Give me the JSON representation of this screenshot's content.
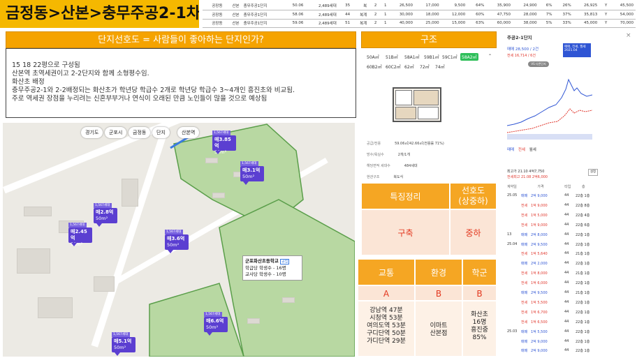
{
  "title": "금정동>산본>충무주공2-1차",
  "top_table": [
    [
      "공장동",
      "산본",
      "충무주공1단지",
      "50.06",
      "2,489세대",
      "35",
      "복",
      "2",
      "1",
      "26,500",
      "17,000",
      "9,500",
      "64%",
      "35,900",
      "24,900",
      "6%",
      "26%",
      "26,925",
      "Y",
      "45,500"
    ],
    [
      "공장동",
      "산본",
      "충무주공1단지",
      "58.06",
      "2,489세대",
      "44",
      "복계",
      "2",
      "1",
      "30,000",
      "18,000",
      "12,000",
      "60%",
      "47,750",
      "28,000",
      "7%",
      "37%",
      "35,813",
      "Y",
      "54,000"
    ],
    [
      "공장동",
      "산본",
      "충무주공1단지",
      "59.06",
      "2,489세대",
      "51",
      "복계",
      "2",
      "1",
      "40,000",
      "25,000",
      "15,000",
      "63%",
      "60,000",
      "38,000",
      "5%",
      "33%",
      "45,000",
      "Y",
      "70,000"
    ]
  ],
  "desc": {
    "header": "단지선호도 = 사람들이 좋아하는 단지인가?",
    "lines": [
      "15 18 22평으로 구성됨",
      "산본역 초역세권이고 2-2단지와 함께 소형평수임.",
      "화산초 배정",
      "충무주공2-1와 2-2배정되는 화산초가 학년당 학급수 2개로 학년당 학급수 3~4개인 흥진초와 비교됨.",
      "주로 역세권 장점을 누리려는 신혼부부거나 연식이 오래된 만큼 노인들이 많을 것으로 예상됨"
    ]
  },
  "map": {
    "chips": [
      "경기도",
      "군포시",
      "금정동",
      "단지"
    ],
    "station": "산본역",
    "pins": [
      {
        "label": "매3.85억",
        "sub": "50m²"
      },
      {
        "label": "매3.1억",
        "sub": "50m²"
      },
      {
        "label": "매2.8억",
        "sub": "50m²"
      },
      {
        "label": "매2.45억",
        "sub": "50m²"
      },
      {
        "label": "매3.6억",
        "sub": "50m²"
      },
      {
        "label": "매6.6억",
        "sub": "50m²"
      },
      {
        "label": "매5.1억",
        "sub": "50m²"
      }
    ],
    "school": {
      "name": "군포화산초등학교",
      "badge": "공립",
      "line1": "학급당 학생수 - 16명",
      "line2": "교사당 학생수 - 10명"
    }
  },
  "structure": {
    "header": "구조",
    "sizes_row1": [
      "50A㎡",
      "51B㎡",
      "58A1㎡",
      "59B1㎡",
      "59C1㎡",
      "58A2㎡"
    ],
    "sizes_row2": [
      "60B2㎡",
      "60C2㎡",
      "62㎡",
      "72㎡",
      "74㎡"
    ],
    "active_size": "58A2㎡",
    "specs": [
      {
        "k": "공급/전용",
        "v": "59.06㎡/42.66㎡(전용률 71%)"
      },
      {
        "k": "방수/욕실수",
        "v": "2개/1개"
      },
      {
        "k": "해당면적 세대수",
        "v": "484세대"
      },
      {
        "k": "현관구조",
        "v": "복도식"
      }
    ]
  },
  "summary": {
    "feature_label": "특징정리",
    "pref_label": "선호도\n(상중하)",
    "feature_value": "구축",
    "pref_value": "중하",
    "cols": [
      "교통",
      "환경",
      "학군"
    ],
    "grades": [
      "A",
      "B",
      "B"
    ],
    "transport": [
      "강남역 47분",
      "시청역 53분",
      "여의도역 53분",
      "구디단역 50분",
      "가디단역 29분"
    ],
    "environment": [
      "이마트",
      "산본점"
    ],
    "school": [
      "화산초",
      "16명",
      "흥진중",
      "85%"
    ]
  },
  "right_panel": {
    "title": "주공2-1단지",
    "price_label": "매매 28,500 / 2건",
    "price_sub": "전세 16,714 / 6건",
    "tabs": [
      "매매",
      "전세",
      "월세"
    ],
    "stat1": "최고가 21.10 4억7,750",
    "stat2": "전세최고 21.08 2억6,000",
    "table_headers": [
      "계약일",
      "가격",
      "타입",
      "층"
    ],
    "rows": [
      {
        "date": "25.05",
        "type": "매매",
        "price": "2억 9,000",
        "area": "44",
        "detail": "22층 1층"
      },
      {
        "date": "",
        "type": "전세",
        "price": "1억 9,000",
        "area": "44",
        "detail": "22층 8층"
      },
      {
        "date": "",
        "type": "전세",
        "price": "1억 5,000",
        "area": "44",
        "detail": "22층 4층"
      },
      {
        "date": "",
        "type": "전세",
        "price": "1억 9,000",
        "area": "44",
        "detail": "22층 6층"
      },
      {
        "date": "13",
        "type": "매매",
        "price": "2억 8,000",
        "area": "44",
        "detail": "22층 1층"
      },
      {
        "date": "25.04",
        "type": "매매",
        "price": "2억 9,500",
        "area": "44",
        "detail": "22층 1층"
      },
      {
        "date": "",
        "type": "전세",
        "price": "1억 5,640",
        "area": "44",
        "detail": "21층 1층"
      },
      {
        "date": "",
        "type": "매매",
        "price": "2억 2,000",
        "area": "44",
        "detail": "22층 1층"
      },
      {
        "date": "",
        "type": "전세",
        "price": "1억 8,000",
        "area": "44",
        "detail": "21층 1층"
      },
      {
        "date": "",
        "type": "전세",
        "price": "1억 6,000",
        "area": "44",
        "detail": "22층 1층"
      },
      {
        "date": "",
        "type": "매매",
        "price": "2억 9,500",
        "area": "44",
        "detail": "21층 1층"
      },
      {
        "date": "",
        "type": "전세",
        "price": "1억 5,500",
        "area": "44",
        "detail": "22층 1층"
      },
      {
        "date": "",
        "type": "전세",
        "price": "1억 6,700",
        "area": "44",
        "detail": "22층 1층"
      },
      {
        "date": "",
        "type": "전세",
        "price": "1억 6,500",
        "area": "44",
        "detail": "22층 1층"
      },
      {
        "date": "25.03",
        "type": "매매",
        "price": "1억 5,500",
        "area": "44",
        "detail": "22층 1층"
      },
      {
        "date": "",
        "type": "매매",
        "price": "2억 9,000",
        "area": "44",
        "detail": "22층 1층"
      },
      {
        "date": "",
        "type": "매매",
        "price": "2억 9,000",
        "area": "44",
        "detail": "22층 1층"
      }
    ]
  }
}
